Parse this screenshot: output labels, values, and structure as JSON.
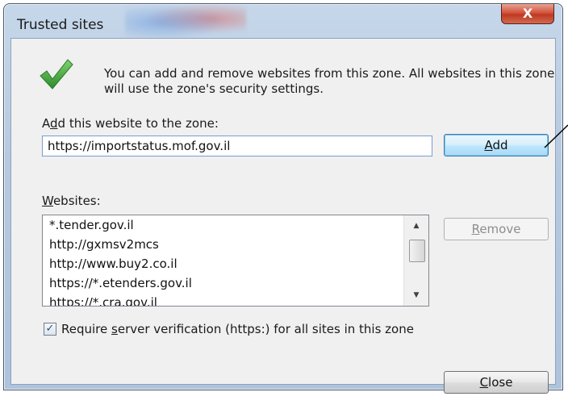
{
  "window": {
    "title": "Trusted sites",
    "close_glyph": "X"
  },
  "info": {
    "icon": "green-check-icon",
    "text": "You can add and remove websites from this zone. All websites in this zone will use the zone's security settings."
  },
  "add_section": {
    "label_prefix": "A",
    "label_mnemonic": "d",
    "label_rest": "d this website to the zone:",
    "input_value": "https://importstatus.mof.gov.il",
    "add_button_mnemonic": "A",
    "add_button_rest": "dd"
  },
  "websites": {
    "label_mnemonic": "W",
    "label_rest": "ebsites:",
    "items": [
      "*.tender.gov.il",
      "http://gxmsv2mcs",
      "http://www.buy2.co.il",
      "https://*.etenders.gov.il",
      "https://*.cra.gov.il"
    ],
    "remove_button_mnemonic": "R",
    "remove_button_rest": "emove"
  },
  "verification": {
    "checked": true,
    "check_glyph": "✓",
    "label_prefix": "Require ",
    "label_mnemonic": "s",
    "label_rest": "erver verification (https:) for all sites in this zone"
  },
  "footer": {
    "close_mnemonic": "C",
    "close_rest": "lose"
  },
  "colors": {
    "focus_accent": "#3c7fb1",
    "close_red": "#c0391f",
    "check_green": "#3aa336"
  }
}
